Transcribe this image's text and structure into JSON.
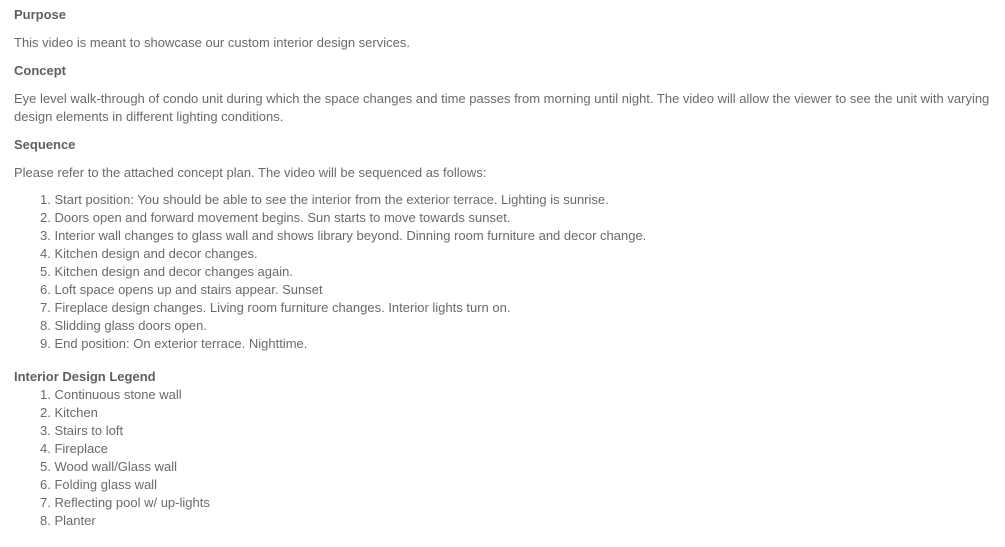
{
  "sections": {
    "purpose": {
      "heading": "Purpose",
      "text": "This video is meant to showcase our custom interior design services."
    },
    "concept": {
      "heading": "Concept",
      "text": "Eye level walk-through of condo unit during which the space changes and time passes from morning until night. The video will allow the viewer to see the unit with varying design elements in different lighting conditions."
    },
    "sequence": {
      "heading": "Sequence",
      "intro": "Please refer to the attached concept plan. The video will be sequenced as follows:",
      "items": [
        {
          "num": "1.",
          "text": "Start position: You should be able to see the interior from the exterior terrace. Lighting is sunrise."
        },
        {
          "num": "2.",
          "text": "Doors open and forward movement begins. Sun starts to move towards sunset."
        },
        {
          "num": "3.",
          "text": "Interior wall changes to glass wall and shows library beyond. Dinning room furniture and decor change."
        },
        {
          "num": "4.",
          "text": "Kitchen design and decor changes."
        },
        {
          "num": "5.",
          "text": "Kitchen design and decor changes again."
        },
        {
          "num": "6.",
          "text": "Loft space opens up and stairs appear. Sunset"
        },
        {
          "num": "7.",
          "text": "Fireplace design changes. Living room furniture changes. Interior lights turn on."
        },
        {
          "num": "8.",
          "text": "Slidding glass doors open."
        },
        {
          "num": "9.",
          "text": "End position: On exterior terrace. Nighttime."
        }
      ]
    },
    "legend": {
      "heading": "Interior Design Legend",
      "items": [
        {
          "num": "1.",
          "text": "Continuous stone wall"
        },
        {
          "num": "2.",
          "text": "Kitchen"
        },
        {
          "num": "3.",
          "text": "Stairs to loft"
        },
        {
          "num": "4.",
          "text": "Fireplace"
        },
        {
          "num": "5.",
          "text": "Wood wall/Glass wall"
        },
        {
          "num": "6.",
          "text": "Folding glass wall"
        },
        {
          "num": "7.",
          "text": "Reflecting pool w/ up-lights"
        },
        {
          "num": "8.",
          "text": "Planter"
        }
      ]
    }
  }
}
